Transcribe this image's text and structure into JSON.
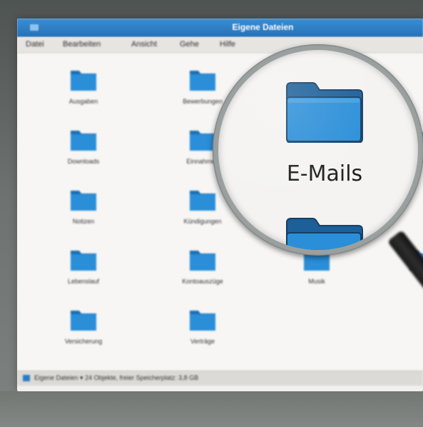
{
  "window": {
    "title": "Eigene Dateien"
  },
  "menu": {
    "items": [
      "Datei",
      "Bearbeiten",
      "Ansicht",
      "Gehe",
      "Hilfe"
    ]
  },
  "folders": [
    {
      "label": "Ausgaben",
      "icon": "folder-icon"
    },
    {
      "label": "Bewerbungen",
      "icon": "folder-icon"
    },
    {
      "label": "Downloads",
      "icon": "folder-icon"
    },
    {
      "label": "Einnahmen",
      "icon": "folder-icon"
    },
    {
      "label": "Notizen",
      "icon": "folder-icon"
    },
    {
      "label": "Kündigungen",
      "icon": "folder-icon"
    },
    {
      "label": "Lebenslauf",
      "icon": "folder-icon"
    },
    {
      "label": "Kontoauszüge",
      "icon": "folder-icon"
    },
    {
      "label": "Musik",
      "icon": "folder-icon"
    },
    {
      "label": "Versicherung",
      "icon": "folder-icon"
    },
    {
      "label": "Verträge",
      "icon": "folder-icon"
    }
  ],
  "magnified": {
    "label": "E-Mails",
    "icon": "folder-icon"
  },
  "statusbar": {
    "text": "Eigene Dateien  ▾   24 Objekte, freier Speicherplatz: 3,8 GB"
  },
  "colors": {
    "titlebar": "#2470b5",
    "folder": "#2a8ed8",
    "folder_dark": "#1b6fb4"
  }
}
